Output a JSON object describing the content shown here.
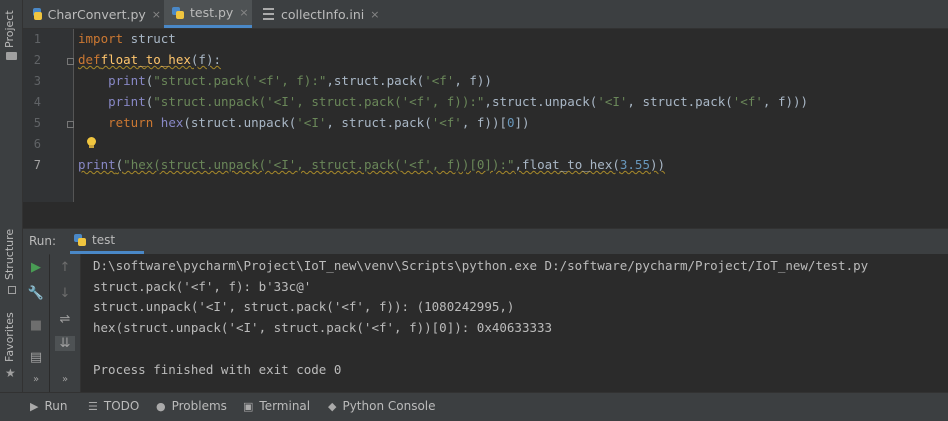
{
  "left_strip": {
    "project": "Project",
    "structure": "Structure",
    "favorites": "Favorites"
  },
  "tabs": [
    {
      "label": "CharConvert.py",
      "icon": "python-file-icon",
      "active": false
    },
    {
      "label": "test.py",
      "icon": "python-file-icon",
      "active": true
    },
    {
      "label": "collectInfo.ini",
      "icon": "ini-file-icon",
      "active": false
    }
  ],
  "tab_close": "×",
  "line_numbers": [
    "1",
    "2",
    "3",
    "4",
    "5",
    "6",
    "7"
  ],
  "code": {
    "l1_kw": "import",
    "l1_rest": " struct",
    "l2_kw": "def",
    "l2_fn": "float_to_hex",
    "l2_rest": "(f):",
    "l3_indent": "    ",
    "l3_fn": "print",
    "l3_a": "(",
    "l3_str": "\"struct.pack('<f', f):\"",
    "l3_b": ",struct.pack(",
    "l3_str2": "'<f'",
    "l3_c": ", f))",
    "l4_indent": "    ",
    "l4_fn": "print",
    "l4_a": "(",
    "l4_str": "\"struct.unpack('<I', struct.pack('<f', f)):\"",
    "l4_b": ",struct.unpack(",
    "l4_str2": "'<I'",
    "l4_c": ", struct.pack(",
    "l4_str3": "'<f'",
    "l4_d": ", f)))",
    "l5_indent": "    ",
    "l5_kw": "return",
    "l5_sp": " ",
    "l5_bi": "hex",
    "l5_a": "(struct.unpack(",
    "l5_str": "'<I'",
    "l5_b": ", struct.pack(",
    "l5_str2": "'<f'",
    "l5_c": ", f))[",
    "l5_num": "0",
    "l5_d": "])",
    "l7_fn": "print",
    "l7_a": "(",
    "l7_str": "\"hex(struct.unpack('<I', struct.pack('<f', f))[0]):\"",
    "l7_b": ",float_to_hex(",
    "l7_num": "3.55",
    "l7_c": "))"
  },
  "run": {
    "label": "Run:",
    "config": "test",
    "output": [
      "D:\\software\\pycharm\\Project\\IoT_new\\venv\\Scripts\\python.exe D:/software/pycharm/Project/IoT_new/test.py",
      "struct.pack('<f', f): b'33c@'",
      "struct.unpack('<I', struct.pack('<f', f)): (1080242995,)",
      "hex(struct.unpack('<I', struct.pack('<f', f))[0]): 0x40633333",
      "",
      "Process finished with exit code 0"
    ]
  },
  "bottom_tabs": [
    {
      "label": "Run",
      "icon": "play-icon"
    },
    {
      "label": "TODO",
      "icon": "todo-icon"
    },
    {
      "label": "Problems",
      "icon": "problems-icon"
    },
    {
      "label": "Terminal",
      "icon": "terminal-icon"
    },
    {
      "label": "Python Console",
      "icon": "python-console-icon"
    }
  ],
  "colors": {
    "keyword": "#cc7832",
    "function": "#ffc66d",
    "string": "#6a8759",
    "number": "#6897bb",
    "run_green": "#499c54",
    "accent": "#4a88c7"
  }
}
